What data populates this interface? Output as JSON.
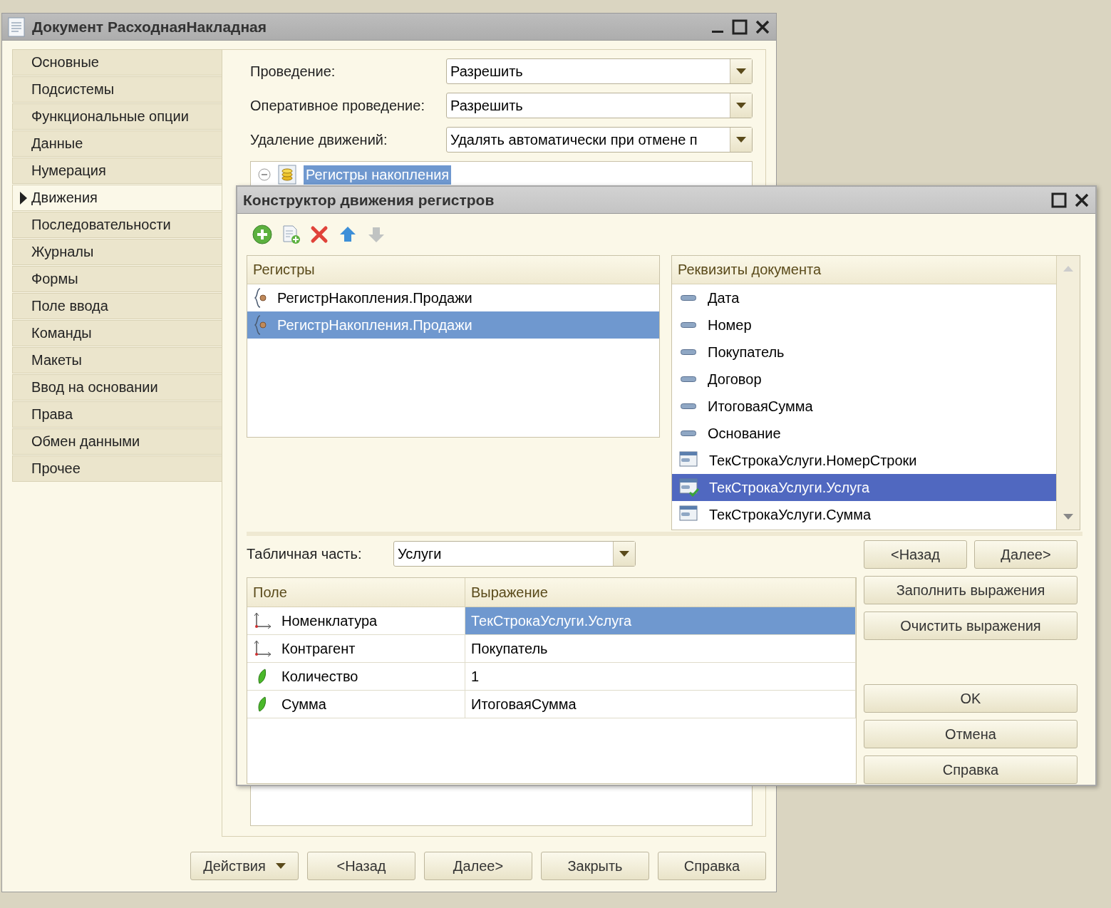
{
  "main_window": {
    "title": "Документ РасходнаяНакладная",
    "tabs": [
      {
        "label": "Основные",
        "selected": false
      },
      {
        "label": "Подсистемы",
        "selected": false
      },
      {
        "label": "Функциональные опции",
        "selected": false
      },
      {
        "label": "Данные",
        "selected": false
      },
      {
        "label": "Нумерация",
        "selected": false
      },
      {
        "label": "Движения",
        "selected": true
      },
      {
        "label": "Последовательности",
        "selected": false
      },
      {
        "label": "Журналы",
        "selected": false
      },
      {
        "label": "Формы",
        "selected": false
      },
      {
        "label": "Поле ввода",
        "selected": false
      },
      {
        "label": "Команды",
        "selected": false
      },
      {
        "label": "Макеты",
        "selected": false
      },
      {
        "label": "Ввод на основании",
        "selected": false
      },
      {
        "label": "Права",
        "selected": false
      },
      {
        "label": "Обмен данными",
        "selected": false
      },
      {
        "label": "Прочее",
        "selected": false
      }
    ],
    "fields": [
      {
        "label": "Проведение:",
        "value": "Разрешить"
      },
      {
        "label": "Оперативное проведение:",
        "value": "Разрешить"
      },
      {
        "label": "Удаление движений:",
        "value": "Удалять автоматически при отмене п"
      }
    ],
    "tree": [
      {
        "label": "Регистры накопления",
        "expanded": true,
        "selected": true
      }
    ],
    "buttons": [
      {
        "label": "Действия",
        "kind": "menu"
      },
      {
        "label": "<Назад",
        "kind": "plain"
      },
      {
        "label": "Далее>",
        "kind": "plain"
      },
      {
        "label": "Закрыть",
        "kind": "plain"
      },
      {
        "label": "Справка",
        "kind": "plain"
      }
    ]
  },
  "dialog": {
    "title": "Конструктор движения регистров",
    "toolbar": [
      {
        "kind": "add",
        "disabled": false
      },
      {
        "kind": "add-copy",
        "disabled": false
      },
      {
        "kind": "delete",
        "disabled": false
      },
      {
        "kind": "up",
        "disabled": false
      },
      {
        "kind": "down",
        "disabled": true
      }
    ],
    "registers": {
      "header": "Регистры",
      "items": [
        {
          "label": "РегистрНакопления.Продажи",
          "selected": false
        },
        {
          "label": "РегистрНакопления.Продажи",
          "selected": true
        }
      ]
    },
    "attributes": {
      "header": "Реквизиты документа",
      "items": [
        {
          "label": "Дата",
          "kind": "attribute",
          "selected": false,
          "used": false
        },
        {
          "label": "Номер",
          "kind": "attribute",
          "selected": false,
          "used": false
        },
        {
          "label": "Покупатель",
          "kind": "attribute",
          "selected": false,
          "used": false
        },
        {
          "label": "Договор",
          "kind": "attribute",
          "selected": false,
          "used": false
        },
        {
          "label": "ИтоговаяСумма",
          "kind": "attribute",
          "selected": false,
          "used": false
        },
        {
          "label": "Основание",
          "kind": "attribute",
          "selected": false,
          "used": false
        },
        {
          "label": "ТекСтрокаУслуги.НомерСтроки",
          "kind": "column",
          "selected": false,
          "used": false
        },
        {
          "label": "ТекСтрокаУслуги.Услуга",
          "kind": "column",
          "selected": true,
          "used": true
        },
        {
          "label": "ТекСтрокаУслуги.Сумма",
          "kind": "column",
          "selected": false,
          "used": false
        }
      ]
    },
    "table_part": {
      "label": "Табличная часть:",
      "value": "Услуги"
    },
    "table": {
      "columns": [
        "Поле",
        "Выражение"
      ],
      "rows": [
        {
          "field": "Номенклатура",
          "kind": "dimension",
          "expression": "ТекСтрокаУслуги.Услуга",
          "selected": true
        },
        {
          "field": "Контрагент",
          "kind": "dimension",
          "expression": "Покупатель",
          "selected": false
        },
        {
          "field": "Количество",
          "kind": "resource",
          "expression": "1",
          "selected": false
        },
        {
          "field": "Сумма",
          "kind": "resource",
          "expression": "ИтоговаяСумма",
          "selected": false
        }
      ]
    },
    "nav_buttons": [
      "<Назад",
      "Далее>"
    ],
    "action_buttons": [
      "Заполнить выражения",
      "Очистить выражения"
    ],
    "dialog_buttons": [
      "OK",
      "Отмена",
      "Справка"
    ]
  }
}
